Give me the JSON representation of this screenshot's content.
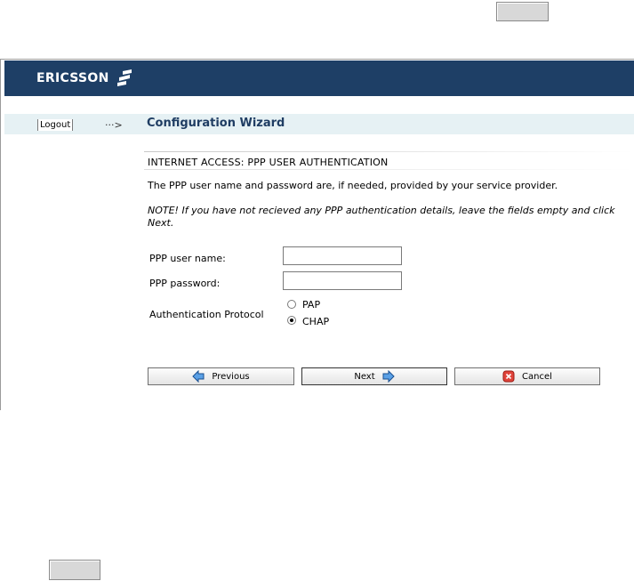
{
  "header": {
    "brand": "ERICSSON"
  },
  "nav": {
    "logout_label": "Logout",
    "arrow": "···>",
    "title": "Configuration Wizard"
  },
  "section": {
    "heading": "INTERNET ACCESS: PPP USER AUTHENTICATION",
    "info": "The PPP user name and password are, if needed, provided by your service provider.",
    "note": "NOTE! If you have not recieved any PPP authentication details, leave the fields empty and click Next."
  },
  "form": {
    "user_label": "PPP user name:",
    "user_value": "",
    "password_label": "PPP password:",
    "password_value": "",
    "auth_label": "Authentication Protocol",
    "options": [
      {
        "label": "PAP",
        "selected": false
      },
      {
        "label": "CHAP",
        "selected": true
      }
    ]
  },
  "buttons": {
    "previous": "Previous",
    "next": "Next",
    "cancel": "Cancel"
  },
  "colors": {
    "header_bg": "#1e3f66",
    "nav_bg": "#e6f1f4",
    "title": "#1f3d63"
  }
}
